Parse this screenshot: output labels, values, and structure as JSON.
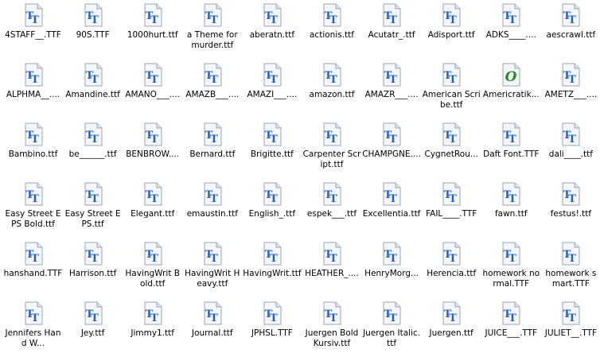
{
  "files": [
    {
      "name": "4STAFF__.TTF",
      "type": "truetype"
    },
    {
      "name": "90S.TTF",
      "type": "truetype"
    },
    {
      "name": "1000hurt.ttf",
      "type": "truetype"
    },
    {
      "name": "a Theme for murder.ttf",
      "type": "truetype"
    },
    {
      "name": "aberatn.ttf",
      "type": "truetype"
    },
    {
      "name": "actionis.ttf",
      "type": "truetype"
    },
    {
      "name": "Acutatr_.ttf",
      "type": "truetype"
    },
    {
      "name": "Adisport.ttf",
      "type": "truetype"
    },
    {
      "name": "ADKS____....",
      "type": "truetype"
    },
    {
      "name": "aescrawl.ttf",
      "type": "truetype"
    },
    {
      "name": "ALPHMA__....",
      "type": "truetype"
    },
    {
      "name": "Amandine.ttf",
      "type": "truetype"
    },
    {
      "name": "AMANO___....",
      "type": "truetype"
    },
    {
      "name": "AMAZB___....",
      "type": "truetype"
    },
    {
      "name": "AMAZI___....",
      "type": "truetype"
    },
    {
      "name": "amazon.ttf",
      "type": "truetype"
    },
    {
      "name": "AMAZR___....",
      "type": "truetype"
    },
    {
      "name": "American Scribe.ttf",
      "type": "truetype"
    },
    {
      "name": "Americratik...",
      "type": "opentype"
    },
    {
      "name": "AMETZ___....",
      "type": "truetype"
    },
    {
      "name": "Bambino.ttf",
      "type": "truetype"
    },
    {
      "name": "be______.ttf",
      "type": "truetype"
    },
    {
      "name": "BENBROW....",
      "type": "truetype"
    },
    {
      "name": "Bernard.ttf",
      "type": "truetype"
    },
    {
      "name": "Brigitte.ttf",
      "type": "truetype"
    },
    {
      "name": "Carpenter Script.ttf",
      "type": "truetype"
    },
    {
      "name": "CHAMPGNE....",
      "type": "truetype"
    },
    {
      "name": "CygnetRou...",
      "type": "truetype"
    },
    {
      "name": "Daft Font.TTF",
      "type": "truetype"
    },
    {
      "name": "dali____.ttf",
      "type": "truetype"
    },
    {
      "name": "Easy Street EPS Bold.ttf",
      "type": "truetype"
    },
    {
      "name": "Easy Street EPS.ttf",
      "type": "truetype"
    },
    {
      "name": "Elegant.ttf",
      "type": "truetype"
    },
    {
      "name": "emaustin.ttf",
      "type": "truetype"
    },
    {
      "name": "English_.ttf",
      "type": "truetype"
    },
    {
      "name": "espek___.ttf",
      "type": "truetype"
    },
    {
      "name": "Excellentia.ttf",
      "type": "truetype"
    },
    {
      "name": "FAIL____.TTF",
      "type": "truetype"
    },
    {
      "name": "fawn.ttf",
      "type": "truetype"
    },
    {
      "name": "festus!.ttf",
      "type": "truetype"
    },
    {
      "name": "hanshand.TTF",
      "type": "truetype"
    },
    {
      "name": "Harrison.ttf",
      "type": "truetype"
    },
    {
      "name": "HavingWrit Bold.ttf",
      "type": "truetype"
    },
    {
      "name": "HavingWrit Heavy.ttf",
      "type": "truetype"
    },
    {
      "name": "HavingWrit.ttf",
      "type": "truetype"
    },
    {
      "name": "HEATHER_....",
      "type": "truetype"
    },
    {
      "name": "HenryMorg...",
      "type": "truetype"
    },
    {
      "name": "Herencia.ttf",
      "type": "truetype"
    },
    {
      "name": "homework normal.TTF",
      "type": "truetype"
    },
    {
      "name": "homework smart.TTF",
      "type": "truetype"
    },
    {
      "name": "Jennifers Hand W...",
      "type": "truetype"
    },
    {
      "name": "Jey.ttf",
      "type": "truetype"
    },
    {
      "name": "Jimmy1.ttf",
      "type": "truetype"
    },
    {
      "name": "Journal.ttf",
      "type": "truetype"
    },
    {
      "name": "JPHSL.TTF",
      "type": "truetype"
    },
    {
      "name": "Juergen Bold Kursiv.ttf",
      "type": "truetype"
    },
    {
      "name": "Juergen Italic.ttf",
      "type": "truetype"
    },
    {
      "name": "Juergen.ttf",
      "type": "truetype"
    },
    {
      "name": "JUICE___.TTF",
      "type": "truetype"
    },
    {
      "name": "JULIET__.TTF",
      "type": "truetype"
    }
  ],
  "colors": {
    "truetype_letter": "#1f5fbf",
    "opentype_letter": "#2a8a2a",
    "page": "#f4f6fa",
    "page_edge": "#9aa6b8"
  }
}
